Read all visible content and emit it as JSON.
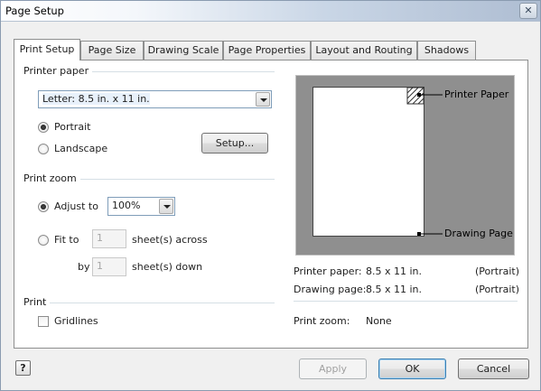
{
  "window": {
    "title": "Page Setup",
    "close_glyph": "✕"
  },
  "tabs": [
    {
      "label": "Print Setup",
      "active": true
    },
    {
      "label": "Page Size",
      "active": false
    },
    {
      "label": "Drawing Scale",
      "active": false
    },
    {
      "label": "Page Properties",
      "active": false
    },
    {
      "label": "Layout and Routing",
      "active": false
    },
    {
      "label": "Shadows",
      "active": false
    }
  ],
  "printer_paper": {
    "group_label": "Printer paper",
    "paper_size": "Letter:  8.5 in. x 11 in.",
    "portrait_label": "Portrait",
    "landscape_label": "Landscape",
    "orientation": "Portrait",
    "setup_label": "Setup..."
  },
  "print_zoom": {
    "group_label": "Print zoom",
    "adjust_to_label": "Adjust to",
    "adjust_value": "100%",
    "fit_to_label": "Fit to",
    "fit_across": "1",
    "across_label": "sheet(s) across",
    "by_label": "by",
    "fit_down": "1",
    "down_label": "sheet(s) down"
  },
  "print": {
    "group_label": "Print",
    "gridlines_label": "Gridlines",
    "gridlines_checked": false
  },
  "preview": {
    "printer_paper_callout": "Printer Paper",
    "drawing_page_callout": "Drawing Page"
  },
  "summary": {
    "printer_paper_label": "Printer paper:",
    "printer_paper_value": "8.5 x 11 in.",
    "printer_paper_orientation": "(Portrait)",
    "drawing_page_label": "Drawing page:",
    "drawing_page_value": "8.5 x 11 in.",
    "drawing_page_orientation": "(Portrait)",
    "print_zoom_label": "Print zoom:",
    "print_zoom_value": "None"
  },
  "footer": {
    "help_glyph": "?",
    "apply_label": "Apply",
    "ok_label": "OK",
    "cancel_label": "Cancel"
  },
  "colors": {
    "accent": "#3c7fb1",
    "preview_bg": "#8f8f8f"
  }
}
